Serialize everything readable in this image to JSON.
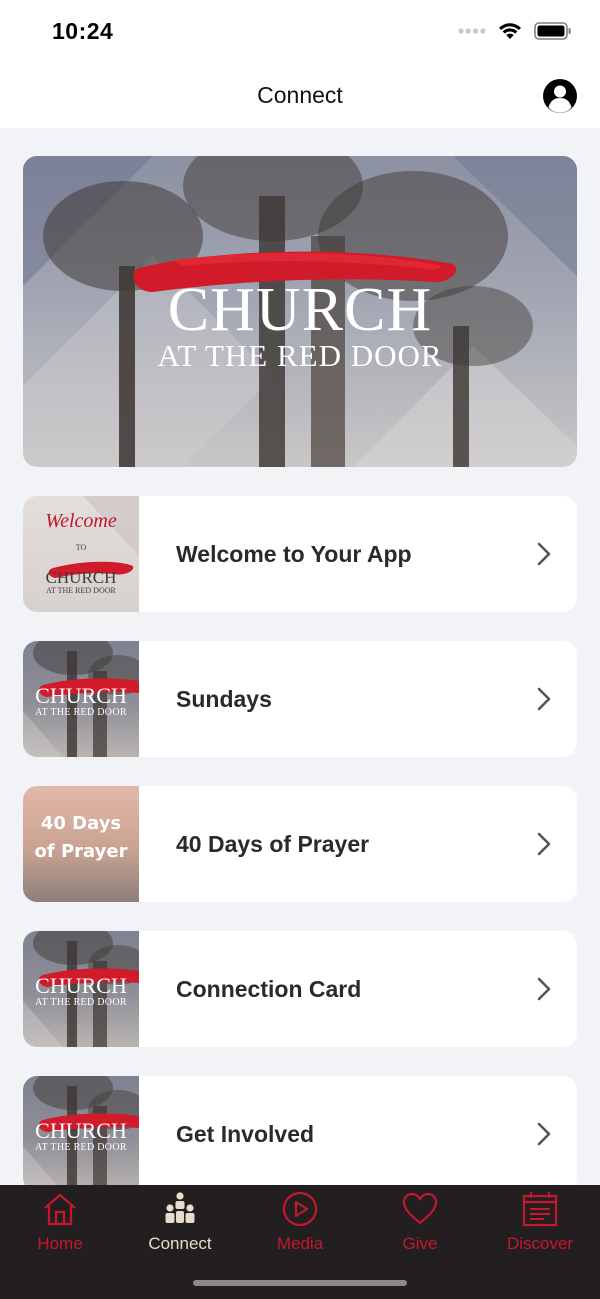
{
  "status_bar": {
    "time": "10:24"
  },
  "nav": {
    "title": "Connect"
  },
  "hero": {
    "title": "CHURCH",
    "subtitle": "AT THE RED DOOR"
  },
  "items": [
    {
      "label": "Welcome to Your App",
      "thumb": {
        "script": "Welcome",
        "to": "TO",
        "title": "CHURCH",
        "subtitle": "AT THE RED DOOR"
      }
    },
    {
      "label": "Sundays",
      "thumb": {
        "title": "CHURCH",
        "subtitle": "AT THE RED DOOR"
      }
    },
    {
      "label": "40 Days of Prayer",
      "thumb": {
        "line1": "40 Days",
        "line2": "of Prayer"
      }
    },
    {
      "label": "Connection Card",
      "thumb": {
        "title": "CHURCH",
        "subtitle": "AT THE RED DOOR"
      }
    },
    {
      "label": "Get Involved",
      "thumb": {
        "title": "CHURCH",
        "subtitle": "AT THE RED DOOR"
      }
    }
  ],
  "tabs": [
    {
      "label": "Home",
      "icon": "home-icon",
      "active": false
    },
    {
      "label": "Connect",
      "icon": "people-icon",
      "active": true
    },
    {
      "label": "Media",
      "icon": "play-icon",
      "active": false
    },
    {
      "label": "Give",
      "icon": "heart-icon",
      "active": false
    },
    {
      "label": "Discover",
      "icon": "calendar-icon",
      "active": false
    }
  ],
  "colors": {
    "accent": "#c4182c",
    "tab_bar": "#231f20",
    "active_tab": "#e6dccb",
    "background": "#f2f3f7"
  }
}
